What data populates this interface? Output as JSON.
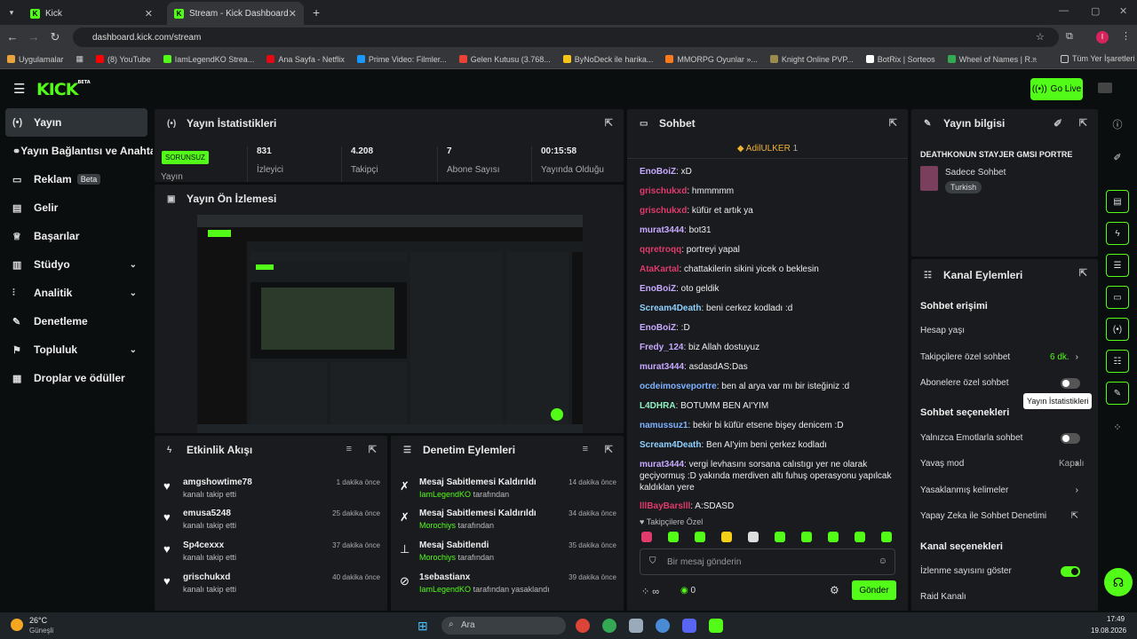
{
  "browser": {
    "tabs": [
      {
        "title": "Kick"
      },
      {
        "title": "Stream - Kick Dashboard"
      }
    ],
    "url": "dashboard.kick.com/stream",
    "bookmarks": [
      "Uygulamalar",
      "(8) YouTube",
      "IamLegendKO Strea...",
      "Ana Sayfa - Netflix",
      "Prime Video: Filmler...",
      "Gelen Kutusu (3.768...",
      "ByNoDeck ile harika...",
      "MMORPG Oyunlar »...",
      "Knight Online PVP...",
      "BotRix | Sorteos",
      "Wheel of Names | R..."
    ],
    "bookmarks_all": "Tüm Yer İşaretleri",
    "profile_initial": "I"
  },
  "app": {
    "logo": "KICK",
    "logo_beta": "BETA",
    "go_live": "Go Live",
    "colors": {
      "accent": "#53fc18",
      "panel": "#191b1f",
      "bg": "#0b0e0f"
    }
  },
  "sidebar": {
    "items": [
      {
        "label": "Yayın",
        "icon": "broadcast-icon"
      },
      {
        "label": "Yayın Bağlantısı ve Anahtarı",
        "icon": "link-icon"
      },
      {
        "label": "Reklam",
        "icon": "ad-icon",
        "badge": "Beta"
      },
      {
        "label": "Gelir",
        "icon": "revenue-icon"
      },
      {
        "label": "Başarılar",
        "icon": "trophy-icon"
      },
      {
        "label": "Stüdyo",
        "icon": "studio-icon"
      },
      {
        "label": "Analitik",
        "icon": "analytics-icon"
      },
      {
        "label": "Denetleme",
        "icon": "wrench-icon"
      },
      {
        "label": "Topluluk",
        "icon": "community-icon"
      },
      {
        "label": "Droplar ve ödüller",
        "icon": "gift-icon"
      }
    ]
  },
  "stats": {
    "title": "Yayın İstatistikleri",
    "status": "SORUNSUZ",
    "status_label": "Yayın",
    "items": [
      {
        "value": "831",
        "label": "İzleyici"
      },
      {
        "value": "4.208",
        "label": "Takipçi"
      },
      {
        "value": "7",
        "label": "Abone Sayısı"
      },
      {
        "value": "00:15:58",
        "label": "Yayında Olduğu"
      }
    ]
  },
  "preview": {
    "title": "Yayın Ön İzlemesi"
  },
  "events": {
    "title": "Etkinlik Akışı",
    "items": [
      {
        "name": "amgshowtime78",
        "sub": "kanalı takip etti",
        "time": "1 dakika önce"
      },
      {
        "name": "emusa5248",
        "sub": "kanalı takip etti",
        "time": "25 dakika önce"
      },
      {
        "name": "Sp4cexxx",
        "sub": "kanalı takip etti",
        "time": "37 dakika önce"
      },
      {
        "name": "grischukxd",
        "sub": "kanalı takip etti",
        "time": "40 dakika önce"
      }
    ]
  },
  "moderation": {
    "title": "Denetim Eylemleri",
    "items": [
      {
        "name": "Mesaj Sabitlemesi Kaldırıldı",
        "by": "IamLegendKO",
        "suffix": "tarafından",
        "time": "14 dakika önce"
      },
      {
        "name": "Mesaj Sabitlemesi Kaldırıldı",
        "by": "Morochiys",
        "suffix": "tarafından",
        "time": "34 dakika önce"
      },
      {
        "name": "Mesaj Sabitlendi",
        "by": "Morochiys",
        "suffix": "tarafından",
        "time": "35 dakika önce"
      },
      {
        "name": "1sebastianx",
        "by": "IamLegendKO",
        "suffix": "tarafından yasaklandı",
        "time": "39 dakika önce"
      }
    ]
  },
  "chat": {
    "title": "Sohbet",
    "pinned_user": "AdilULKER",
    "pinned_count": "1",
    "messages": [
      {
        "user": "EnoBoiZ",
        "color": "#c7a9ff",
        "text": "xD"
      },
      {
        "user": "grischukxd",
        "color": "#e03b6b",
        "text": "hmmmmm"
      },
      {
        "user": "grischukxd",
        "color": "#e03b6b",
        "text": "küfür et artık ya"
      },
      {
        "user": "murat3444",
        "color": "#c7a9ff",
        "text": "bot31"
      },
      {
        "user": "qqretroqq",
        "color": "#e03b6b",
        "text": "portreyi yapal"
      },
      {
        "user": "AtaKartal",
        "color": "#e03b6b",
        "text": "chattakilerin sikini yicek o beklesin"
      },
      {
        "user": "EnoBoiZ",
        "color": "#c7a9ff",
        "text": "oto geldik"
      },
      {
        "user": "Scream4Death",
        "color": "#8fd1ff",
        "text": "beni cerkez kodladı :d"
      },
      {
        "user": "EnoBoiZ",
        "color": "#c7a9ff",
        "text": ":D"
      },
      {
        "user": "Fredy_124",
        "color": "#c7a9ff",
        "text": "biz Allah dostuyuz"
      },
      {
        "user": "murat3444",
        "color": "#c7a9ff",
        "text": "asdasdAS:Das"
      },
      {
        "user": "ocdeimosveportre",
        "color": "#7fb3ff",
        "text": "ben al arya var mı bir isteğiniz :d"
      },
      {
        "user": "L4DHRA",
        "color": "#8ff0c0",
        "text": "BOTUMM BEN AI'YIM"
      },
      {
        "user": "namussuz1",
        "color": "#7fb3ff",
        "text": "bekir bi küfür etsene bişey denicem :D"
      },
      {
        "user": "Scream4Death",
        "color": "#8fd1ff",
        "text": "Ben AI'yim beni çerkez kodladı"
      },
      {
        "user": "murat3444",
        "color": "#c7a9ff",
        "text": "vergi levhasını sorsana calıstıgı yer ne olarak geçiyormuş :D yakında merdiven altı fuhuş operasyonu yapılcak kaldıklan yere"
      },
      {
        "user": "lllBayBarslll",
        "color": "#e03b6b",
        "text": "A:SDASD"
      }
    ],
    "followers_only": "Takipçilere Özel",
    "input_placeholder": "Bir mesaj gönderin",
    "points_label": "∞",
    "points_count": "0",
    "send": "Gönder"
  },
  "info": {
    "title": "Yayın bilgisi",
    "stream_title": "DEATHKONUN STAYJER GMSI PORTRE",
    "category": "Sadece Sohbet",
    "language": "Turkish"
  },
  "channel_actions": {
    "title": "Kanal Eylemleri",
    "chat_access": "Sohbet erişimi",
    "account_age": "Hesap yaşı",
    "followers_chat": "Takipçilere özel sohbet",
    "followers_chat_value": "6 dk.",
    "subs_chat": "Abonelere özel sohbet",
    "chat_options": "Sohbet seçenekleri",
    "emote_only": "Yalnızca Emotlarla sohbet",
    "slow_mode": "Yavaş mod",
    "slow_mode_value": "Kapalı",
    "banned_words": "Yasaklanmış kelimeler",
    "ai_mod": "Yapay Zeka ile Sohbet Denetimi",
    "channel_options": "Kanal seçenekleri",
    "show_viewers": "İzlenme sayısını göster",
    "raid": "Raid Kanalı"
  },
  "tooltip": "Yayın İstatistikleri",
  "taskbar": {
    "temp": "26°C",
    "weather": "Güneşli",
    "search": "Ara",
    "time": "17:49",
    "date": "19.08.2026"
  }
}
